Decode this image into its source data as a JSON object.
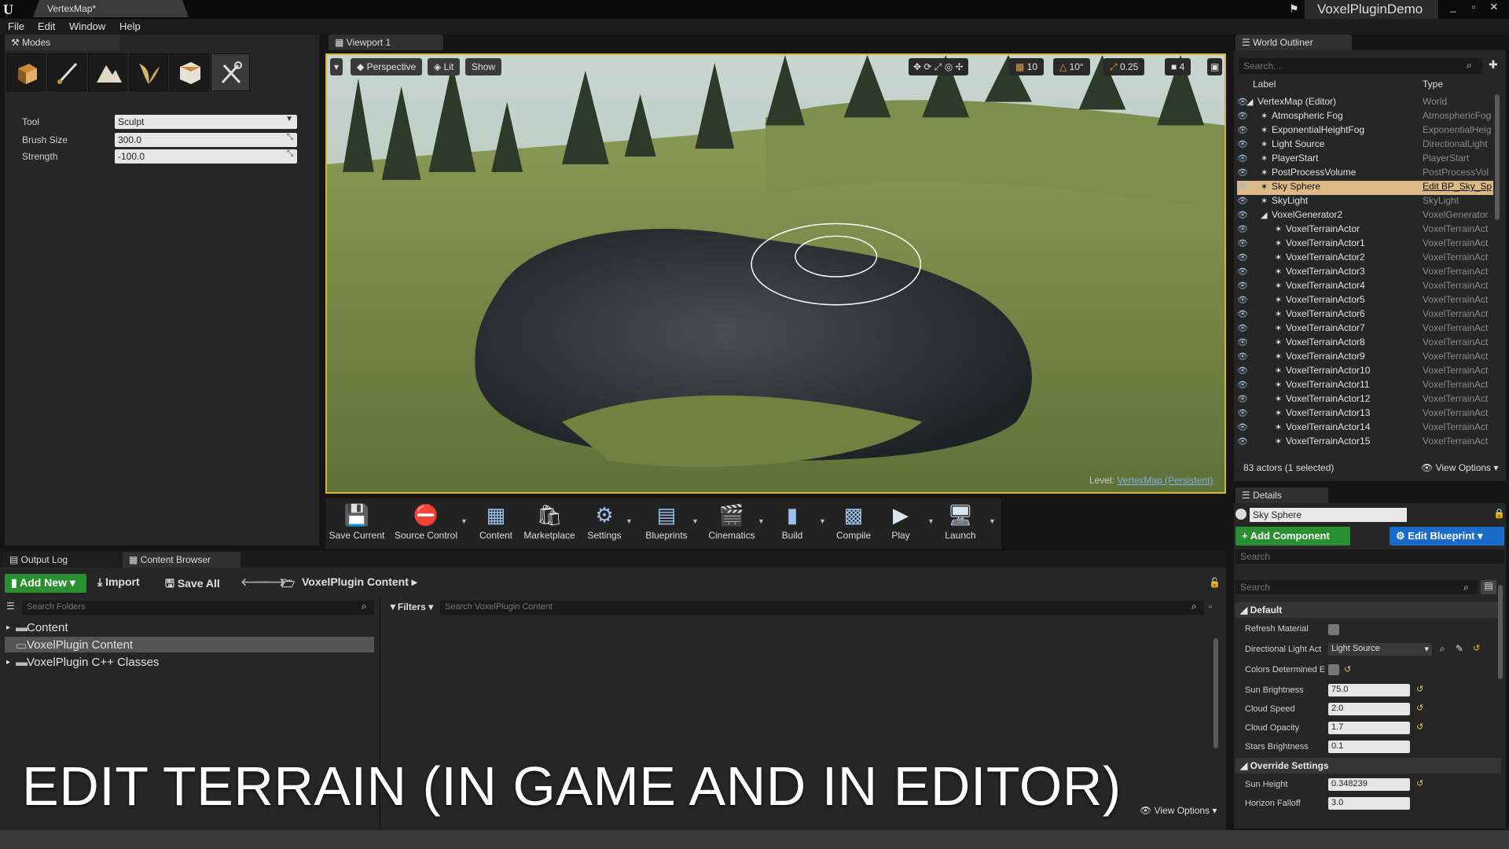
{
  "titlebar": {
    "doc_tab": "VertexMap*",
    "project": "VoxelPluginDemo"
  },
  "menu": [
    "File",
    "Edit",
    "Window",
    "Help"
  ],
  "modes": {
    "tab": "Modes",
    "props": [
      {
        "label": "Tool",
        "value": "Sculpt"
      },
      {
        "label": "Brush Size",
        "value": "300.0"
      },
      {
        "label": "Strength",
        "value": "-100.0"
      }
    ]
  },
  "viewport": {
    "tab": "Viewport 1",
    "perspective": "Perspective",
    "lit": "Lit",
    "show": "Show",
    "grid_snap": "10",
    "rot_snap": "10°",
    "scale_snap": "0.25",
    "cam_speed": "4",
    "level_prefix": "Level:",
    "level_name": "VertexMap (Persistent)"
  },
  "toolbar": [
    {
      "label": "Save Current"
    },
    {
      "label": "Source Control"
    },
    {
      "label": "Content"
    },
    {
      "label": "Marketplace"
    },
    {
      "label": "Settings"
    },
    {
      "label": "Blueprints"
    },
    {
      "label": "Cinematics"
    },
    {
      "label": "Build"
    },
    {
      "label": "Compile"
    },
    {
      "label": "Play"
    },
    {
      "label": "Launch"
    }
  ],
  "outliner": {
    "tab": "World Outliner",
    "search_placeholder": "Search...",
    "col_label": "Label",
    "col_type": "Type",
    "rows": [
      {
        "label": "VertexMap (Editor)",
        "type": "World"
      },
      {
        "label": "Atmospheric Fog",
        "type": "AtmosphericFog"
      },
      {
        "label": "ExponentialHeightFog",
        "type": "ExponentialHeig"
      },
      {
        "label": "Light Source",
        "type": "DirectionalLight"
      },
      {
        "label": "PlayerStart",
        "type": "PlayerStart"
      },
      {
        "label": "PostProcessVolume",
        "type": "PostProcessVol"
      },
      {
        "label": "Sky Sphere",
        "type": "Edit BP_Sky_Sp"
      },
      {
        "label": "SkyLight",
        "type": "SkyLight"
      },
      {
        "label": "VoxelGenerator2",
        "type": "VoxelGenerator"
      },
      {
        "label": "VoxelTerrainActor",
        "type": "VoxelTerrainAct"
      },
      {
        "label": "VoxelTerrainActor1",
        "type": "VoxelTerrainAct"
      },
      {
        "label": "VoxelTerrainActor2",
        "type": "VoxelTerrainAct"
      },
      {
        "label": "VoxelTerrainActor3",
        "type": "VoxelTerrainAct"
      },
      {
        "label": "VoxelTerrainActor4",
        "type": "VoxelTerrainAct"
      },
      {
        "label": "VoxelTerrainActor5",
        "type": "VoxelTerrainAct"
      },
      {
        "label": "VoxelTerrainActor6",
        "type": "VoxelTerrainAct"
      },
      {
        "label": "VoxelTerrainActor7",
        "type": "VoxelTerrainAct"
      },
      {
        "label": "VoxelTerrainActor8",
        "type": "VoxelTerrainAct"
      },
      {
        "label": "VoxelTerrainActor9",
        "type": "VoxelTerrainAct"
      },
      {
        "label": "VoxelTerrainActor10",
        "type": "VoxelTerrainAct"
      },
      {
        "label": "VoxelTerrainActor11",
        "type": "VoxelTerrainAct"
      },
      {
        "label": "VoxelTerrainActor12",
        "type": "VoxelTerrainAct"
      },
      {
        "label": "VoxelTerrainActor13",
        "type": "VoxelTerrainAct"
      },
      {
        "label": "VoxelTerrainActor14",
        "type": "VoxelTerrainAct"
      },
      {
        "label": "VoxelTerrainActor15",
        "type": "VoxelTerrainAct"
      }
    ],
    "count": "83 actors (1 selected)",
    "view_options": "View Options"
  },
  "details": {
    "tab": "Details",
    "name": "Sky Sphere",
    "add_component": "+ Add Component",
    "edit_blueprint": "Edit Blueprint",
    "search_placeholder": "Search",
    "cat_default": "Default",
    "cat_override": "Override Settings",
    "refresh_material": "Refresh Material",
    "directional_light_label": "Directional Light Act",
    "directional_light_value": "Light Source",
    "colors_determined": "Colors Determined E",
    "rows": [
      {
        "label": "Sun Brightness",
        "value": "75.0"
      },
      {
        "label": "Cloud Speed",
        "value": "2.0"
      },
      {
        "label": "Cloud Opacity",
        "value": "1.7"
      },
      {
        "label": "Stars Brightness",
        "value": "0.1"
      }
    ],
    "sun_height_label": "Sun Height",
    "sun_height_value": "0.348239",
    "horizon_falloff_label": "Horizon Falloff",
    "horizon_falloff_value": "3.0"
  },
  "content_browser": {
    "output_tab": "Output Log",
    "tab": "Content Browser",
    "add_new": "Add New",
    "import": "Import",
    "save_all": "Save All",
    "path": "VoxelPlugin Content",
    "folder_search_placeholder": "Search Folders",
    "filters": "Filters",
    "asset_search_placeholder": "Search VoxelPlugin Content",
    "tree": [
      "Content",
      "VoxelPlugin Content",
      "VoxelPlugin C++ Classes"
    ],
    "view_options": "View Options"
  },
  "caption": "EDIT TERRAIN (IN GAME AND IN EDITOR)",
  "colors": {
    "accent_green": "#2a8f30",
    "accent_blue": "#1b6bc9",
    "viewport_border": "#d8b33b",
    "selection": "#ddb987"
  }
}
